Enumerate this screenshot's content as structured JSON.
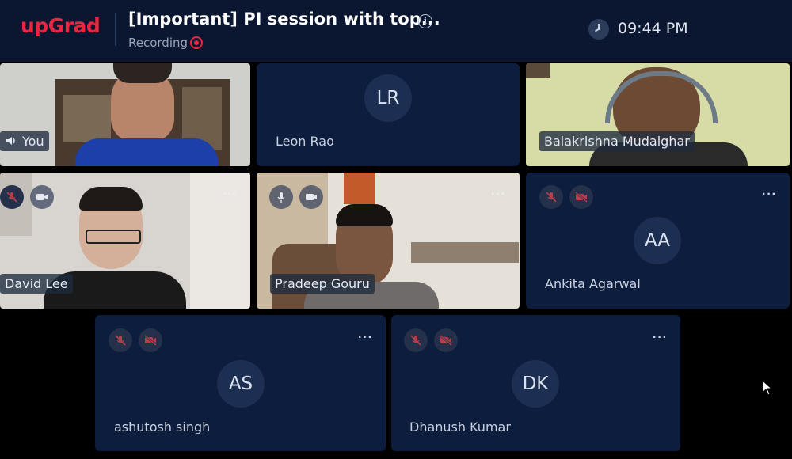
{
  "header": {
    "logo": "upGrad",
    "title": "[Important] PI session with top...",
    "info_icon": "info-icon",
    "recording_label": "Recording",
    "time": "09:44 PM"
  },
  "participants": [
    {
      "name": "You",
      "type": "video",
      "speaking": true
    },
    {
      "name": "Leon Rao",
      "initials": "LR",
      "type": "avatar"
    },
    {
      "name": "Balakrishna Mudalghar",
      "type": "video"
    },
    {
      "name": "David Lee",
      "type": "video",
      "mic": "muted",
      "camera": "on"
    },
    {
      "name": "Pradeep Gouru",
      "type": "video",
      "mic": "on",
      "camera": "on"
    },
    {
      "name": "Ankita Agarwal",
      "initials": "AA",
      "type": "avatar",
      "mic": "muted",
      "camera": "off"
    },
    {
      "name": "ashutosh singh",
      "initials": "AS",
      "type": "avatar",
      "mic": "muted",
      "camera": "off"
    },
    {
      "name": "Dhanush Kumar",
      "initials": "DK",
      "type": "avatar",
      "mic": "muted",
      "camera": "off"
    }
  ],
  "colors": {
    "header_bg": "#0b1730",
    "tile_bg": "#0d1d3e",
    "brand_red": "#e8273f",
    "avatar_bg": "#1c2f52"
  }
}
